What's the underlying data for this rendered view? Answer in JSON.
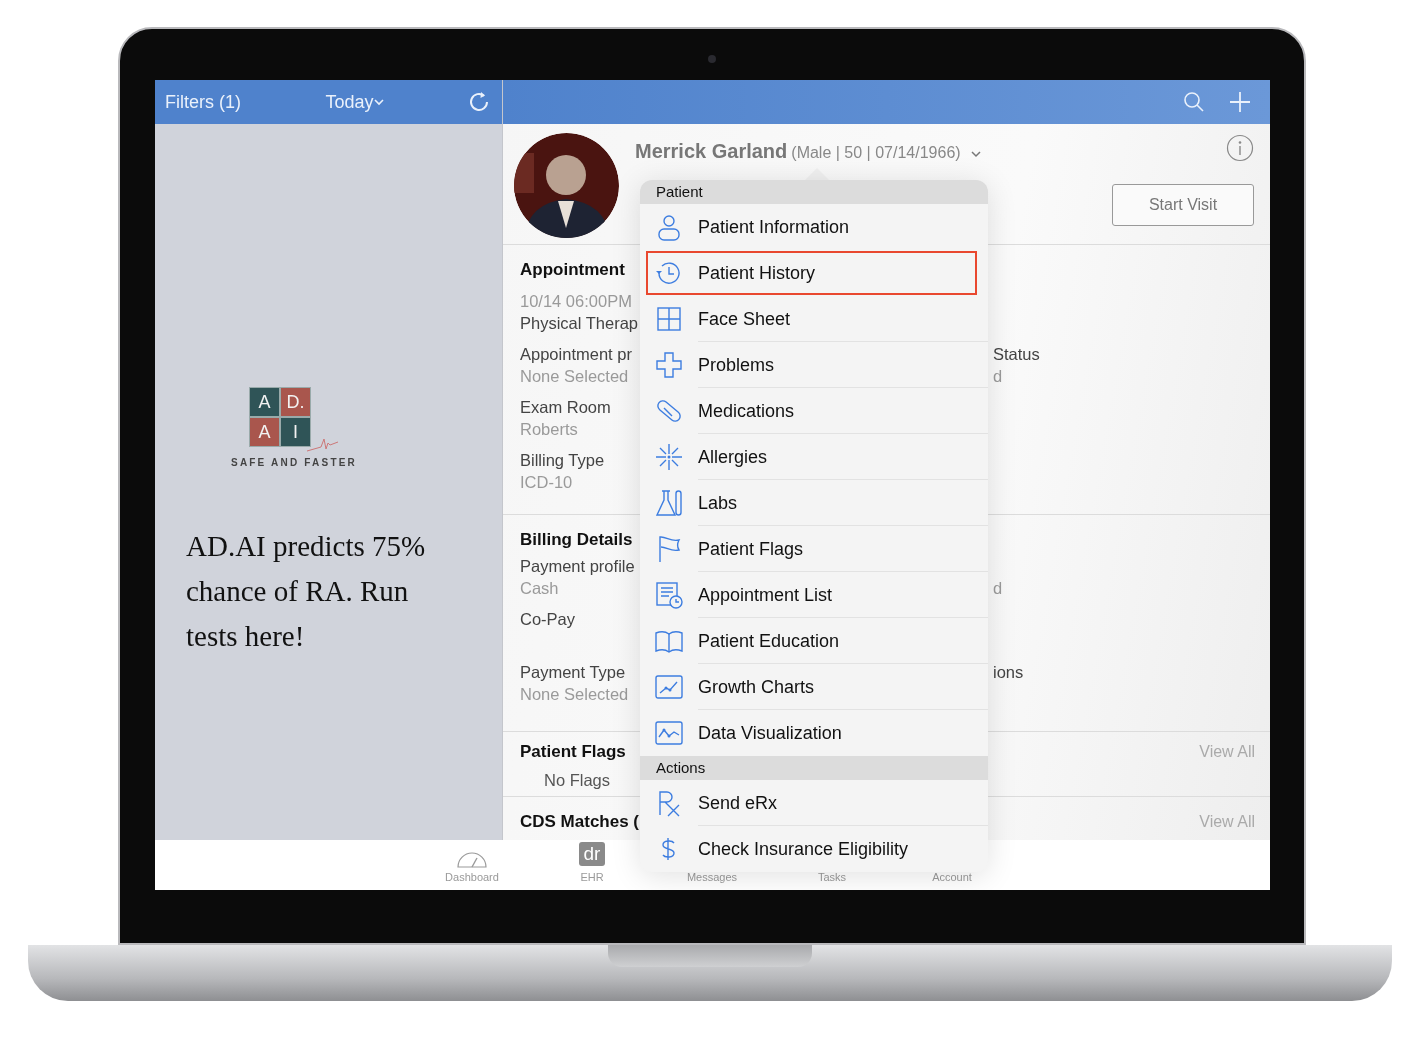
{
  "top_bar": {
    "filters": "Filters (1)",
    "date": "Today"
  },
  "promo": {
    "logo_letters": [
      "A",
      "D.",
      "A",
      "I"
    ],
    "tagline": "SAFE AND FASTER",
    "message": "AD.AI predicts 75% chance of RA. Run tests here!"
  },
  "patient": {
    "name": "Merrick Garland",
    "details": "(Male | 50 | 07/14/1966)",
    "start_visit": "Start Visit"
  },
  "appointment": {
    "title": "Appointment",
    "datetime": "10/14 06:00PM",
    "type": "Physical Therap",
    "rows": [
      {
        "left": {
          "label": "Appointment pr",
          "value": "None Selected"
        },
        "right": {
          "label": "Status",
          "value": "d"
        }
      },
      {
        "left": {
          "label": "Exam Room",
          "value": "Roberts"
        }
      },
      {
        "left": {
          "label": "Billing Type",
          "value": "ICD-10"
        }
      }
    ]
  },
  "billing": {
    "title": "Billing Details",
    "rows": [
      {
        "left": {
          "label": "Payment profile",
          "value": "Cash"
        },
        "right": {
          "value": "d"
        }
      },
      {
        "left": {
          "label": "Co-Pay"
        }
      },
      {
        "left": {
          "label": "Payment Type",
          "value": "None Selected"
        },
        "right": {
          "label": "ions"
        }
      }
    ]
  },
  "patient_flags": {
    "title": "Patient Flags",
    "link": "View All",
    "empty": "No Flags"
  },
  "cds": {
    "title": "CDS Matches (",
    "link": "View All"
  },
  "menu": {
    "sections": [
      {
        "title": "Patient",
        "items": [
          {
            "label": "Patient Information",
            "selected": false
          },
          {
            "label": "Patient History",
            "selected": true
          },
          {
            "label": "Face Sheet",
            "selected": false
          },
          {
            "label": "Problems",
            "selected": false
          },
          {
            "label": "Medications",
            "selected": false
          },
          {
            "label": "Allergies",
            "selected": false
          },
          {
            "label": "Labs",
            "selected": false
          },
          {
            "label": "Patient Flags",
            "selected": false
          },
          {
            "label": "Appointment List",
            "selected": false
          },
          {
            "label": "Patient Education",
            "selected": false
          },
          {
            "label": "Growth Charts",
            "selected": false
          },
          {
            "label": "Data Visualization",
            "selected": false
          }
        ]
      },
      {
        "title": "Actions",
        "items": [
          {
            "label": "Send eRx",
            "selected": false
          },
          {
            "label": "Check Insurance Eligibility",
            "selected": false
          }
        ]
      }
    ]
  },
  "tab_bar": [
    {
      "label": "Dashboard"
    },
    {
      "label": "EHR",
      "icon_text": "dr"
    },
    {
      "label": "Messages"
    },
    {
      "label": "Tasks"
    },
    {
      "label": "Account"
    }
  ]
}
